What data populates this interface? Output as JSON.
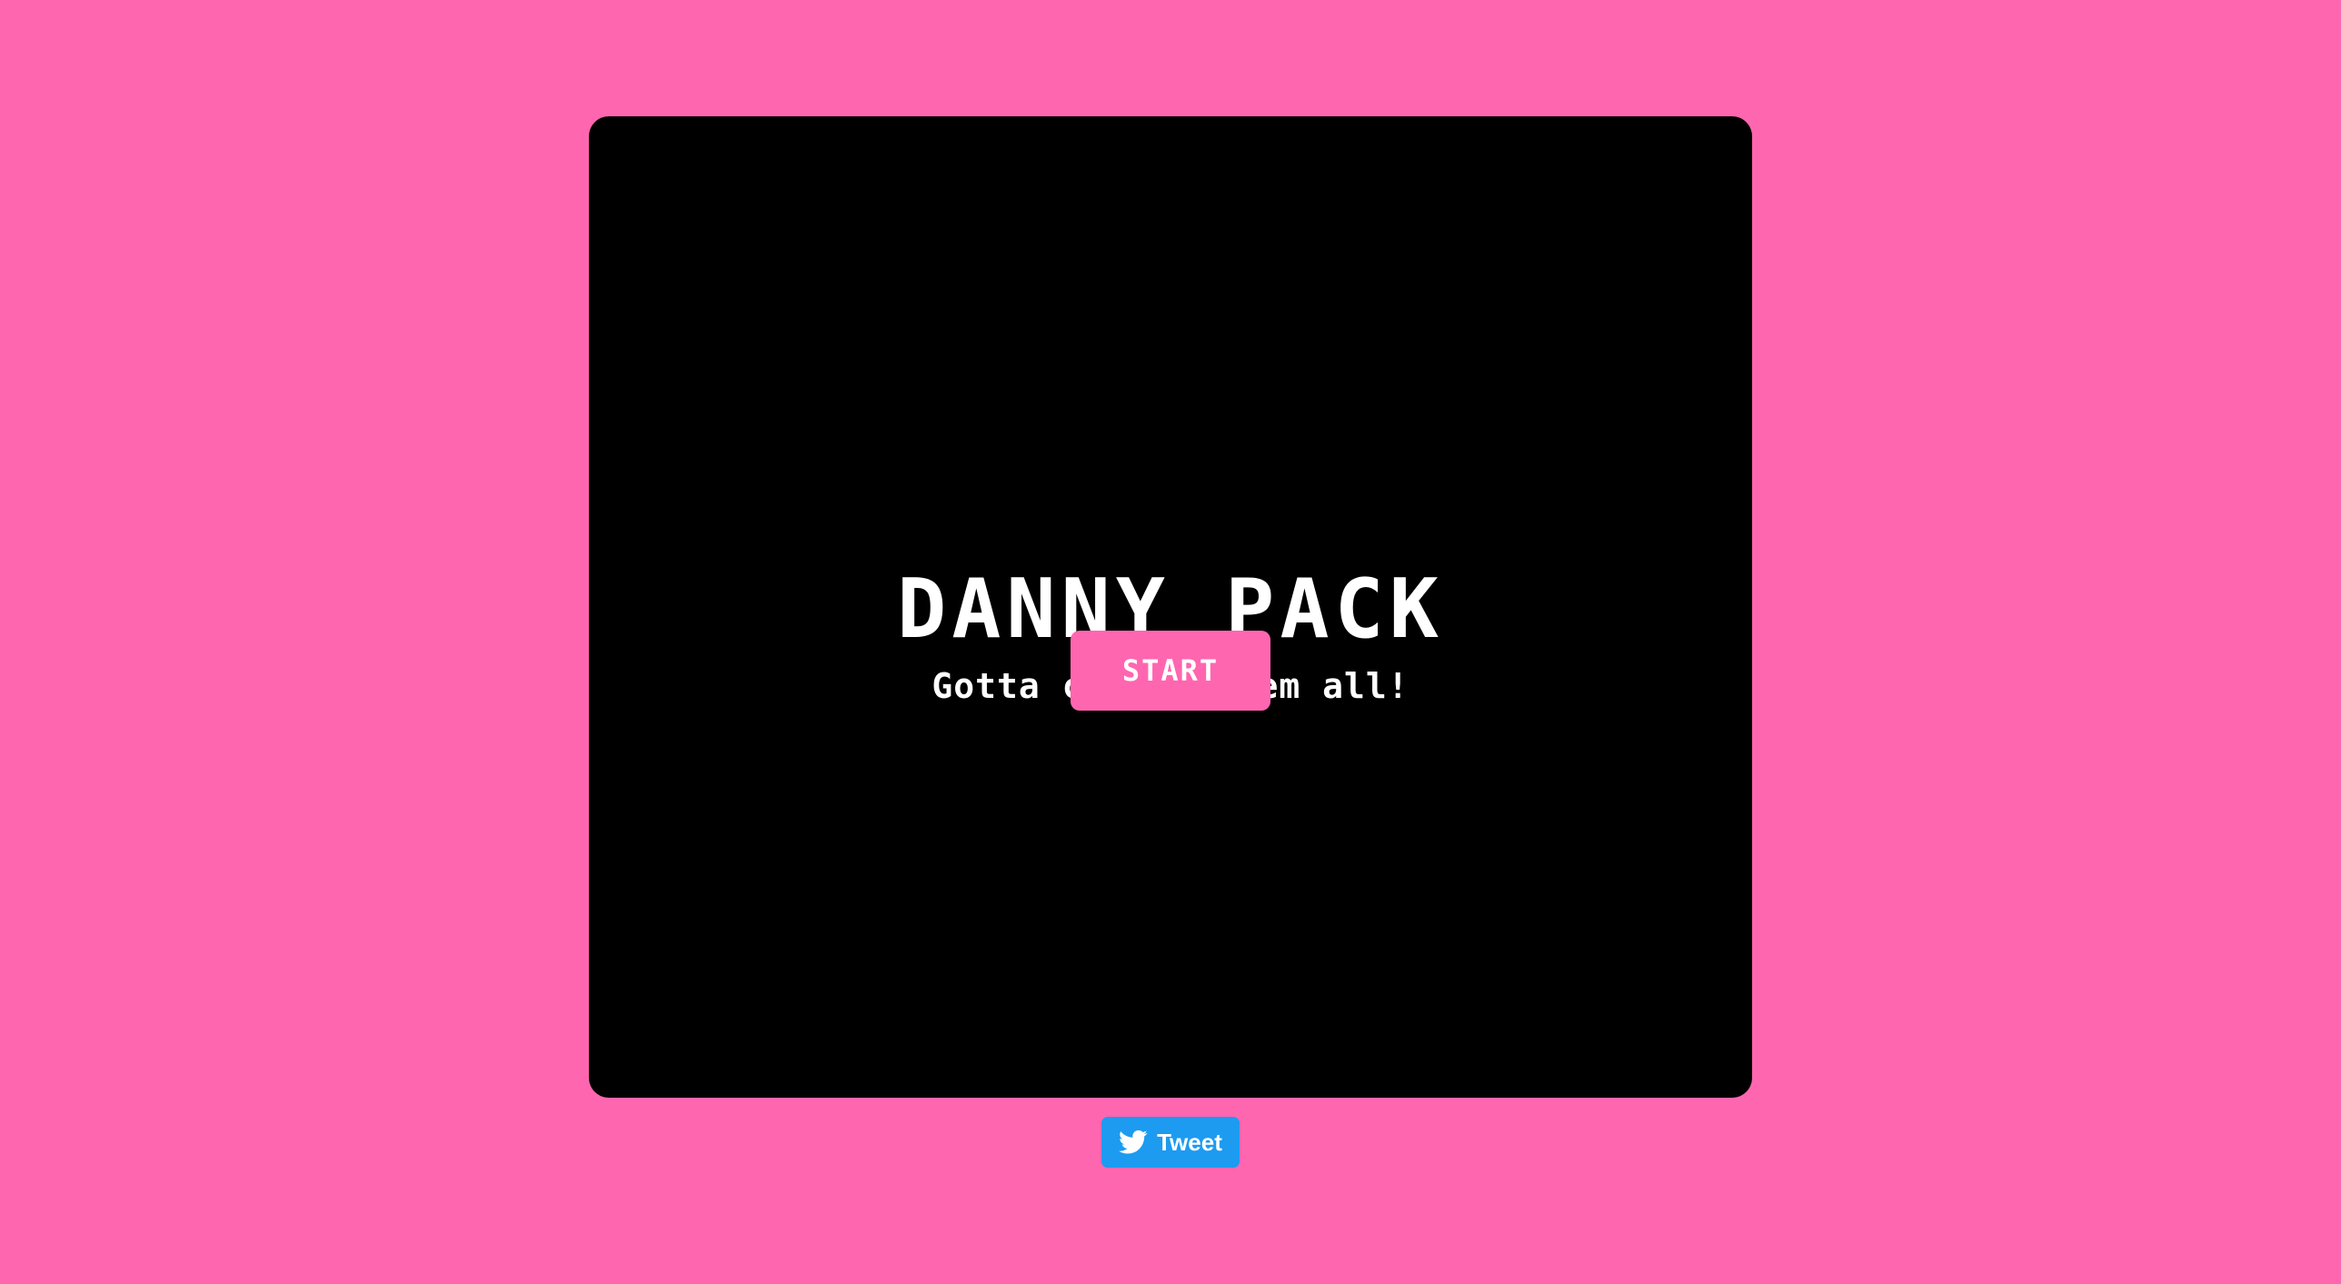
{
  "game": {
    "title": "DANNY PACK",
    "subtitle": "Gotta collect 'em all!",
    "start_label": "START"
  },
  "share": {
    "tweet_label": "Tweet",
    "icon": "twitter-bird-icon"
  },
  "colors": {
    "background": "#ff66b0",
    "game_frame": "#000000",
    "start_button": "#ff66b0",
    "tweet_button": "#1d9bf0",
    "text": "#ffffff"
  }
}
